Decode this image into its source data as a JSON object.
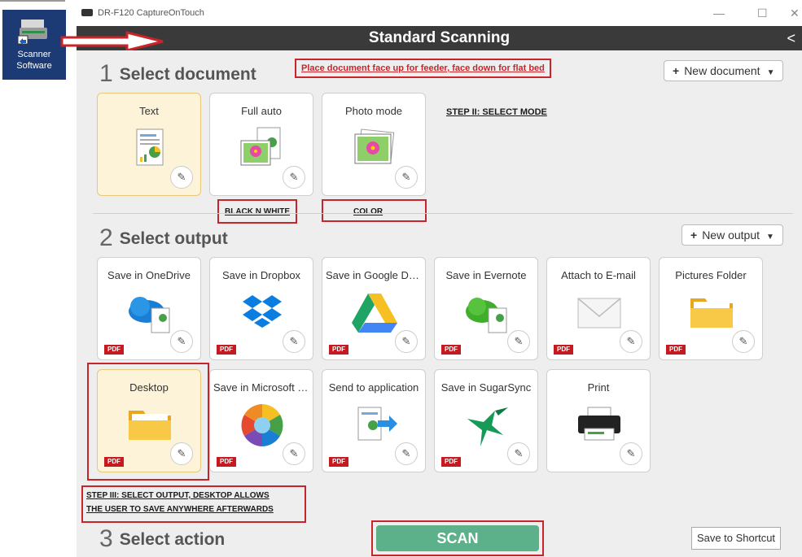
{
  "desktop": {
    "icon_label": "Scanner Software"
  },
  "window": {
    "title": "DR-F120 CaptureOnTouch",
    "minimize": "—",
    "maximize": "☐",
    "close": "✕"
  },
  "header": {
    "title": "Standard Scanning",
    "collapse": "<"
  },
  "step1": {
    "number": "1",
    "title": "Select document",
    "note": "Place document face up for feeder, face down for flat bed",
    "new_button": "New document",
    "mode_note": "STEP II: SELECT MODE",
    "cards": [
      {
        "label": "Text",
        "icon": "document-icon",
        "selected": true
      },
      {
        "label": "Full auto",
        "icon": "photo-doc-icon",
        "selected": false
      },
      {
        "label": "Photo mode",
        "icon": "photo-icon",
        "selected": false
      }
    ],
    "bw_note": "BLACK N WHITE",
    "color_note": "COLOR"
  },
  "step2": {
    "number": "2",
    "title": "Select output",
    "new_button": "New output",
    "pdf_badge": "PDF",
    "cards": [
      {
        "label": "Save in OneDrive",
        "icon": "onedrive-icon",
        "selected": false
      },
      {
        "label": "Save in Dropbox",
        "icon": "dropbox-icon",
        "selected": false
      },
      {
        "label": "Save in Google Dri...",
        "icon": "google-drive-icon",
        "selected": false
      },
      {
        "label": "Save in Evernote",
        "icon": "evernote-icon",
        "selected": false
      },
      {
        "label": "Attach to E-mail",
        "icon": "envelope-icon",
        "selected": false
      },
      {
        "label": "Pictures Folder",
        "icon": "folder-icon",
        "selected": false
      },
      {
        "label": "Desktop",
        "icon": "folder-icon",
        "selected": true
      },
      {
        "label": "Save in Microsoft S...",
        "icon": "sharepoint-icon",
        "selected": false
      },
      {
        "label": "Send to application",
        "icon": "send-app-icon",
        "selected": false
      },
      {
        "label": "Save in SugarSync",
        "icon": "sugarsync-icon",
        "selected": false
      },
      {
        "label": "Print",
        "icon": "printer-icon",
        "selected": false
      }
    ],
    "output_note_line1": "STEP III: SELECT OUTPUT, DESKTOP ALLOWS",
    "output_note_line2": "THE USER TO SAVE ANYWHERE AFTERWARDS"
  },
  "step3": {
    "number": "3",
    "title": "Select action",
    "scan_button": "SCAN",
    "shortcut_button": "Save to Shortcut"
  },
  "colors": {
    "accent_red": "#c8252b",
    "scan_green": "#5cb08a",
    "selected_bg": "#fdf3d8",
    "header_bg": "#3a3a3a"
  }
}
